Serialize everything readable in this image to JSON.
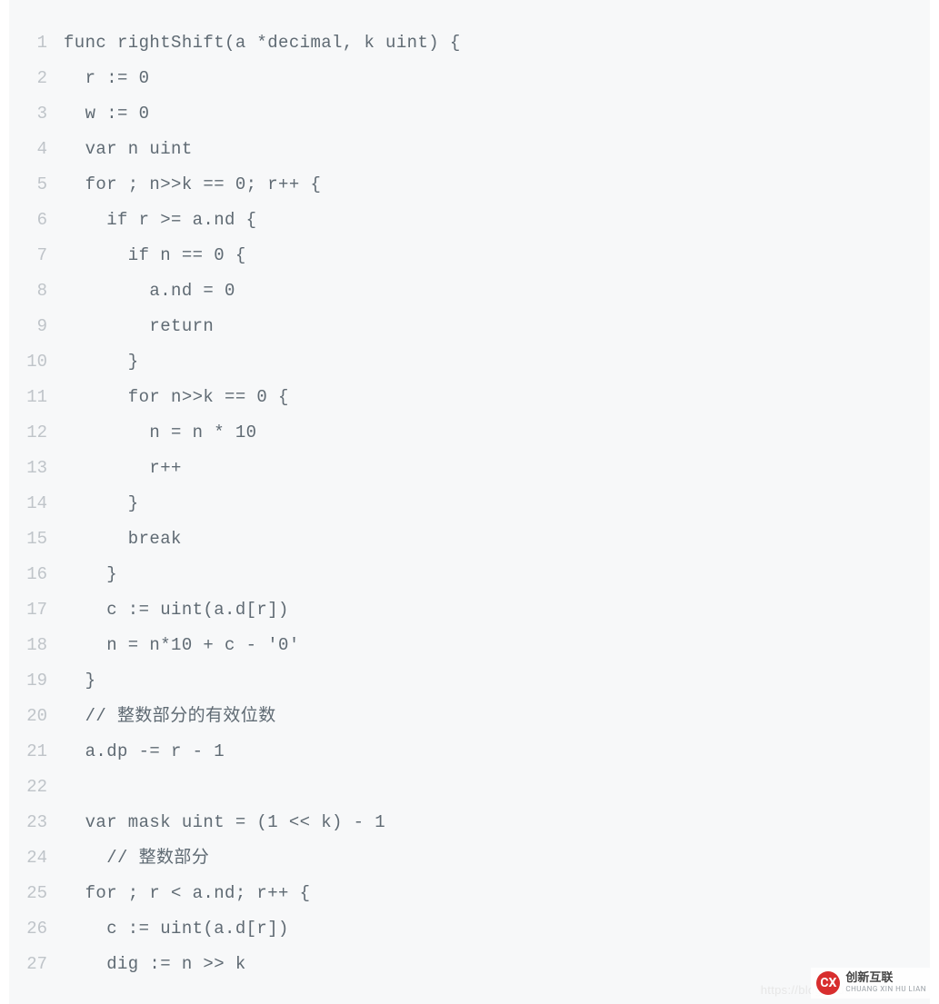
{
  "code": {
    "lines": [
      "func rightShift(a *decimal, k uint) {",
      "  r := 0",
      "  w := 0",
      "  var n uint",
      "  for ; n>>k == 0; r++ {",
      "    if r >= a.nd {",
      "      if n == 0 {",
      "        a.nd = 0",
      "        return",
      "      }",
      "      for n>>k == 0 {",
      "        n = n * 10",
      "        r++",
      "      }",
      "      break",
      "    }",
      "    c := uint(a.d[r])",
      "    n = n*10 + c - '0'",
      "  }",
      "  // 整数部分的有效位数",
      "  a.dp -= r - 1",
      "",
      "  var mask uint = (1 << k) - 1",
      "    // 整数部分",
      "  for ; r < a.nd; r++ {",
      "    c := uint(a.d[r])",
      "    dig := n >> k"
    ]
  },
  "watermark": "https://blog.csdn.n",
  "brand": {
    "icon_letter": "CX",
    "cn": "创新互联",
    "en": "CHUANG XIN HU LIAN"
  }
}
